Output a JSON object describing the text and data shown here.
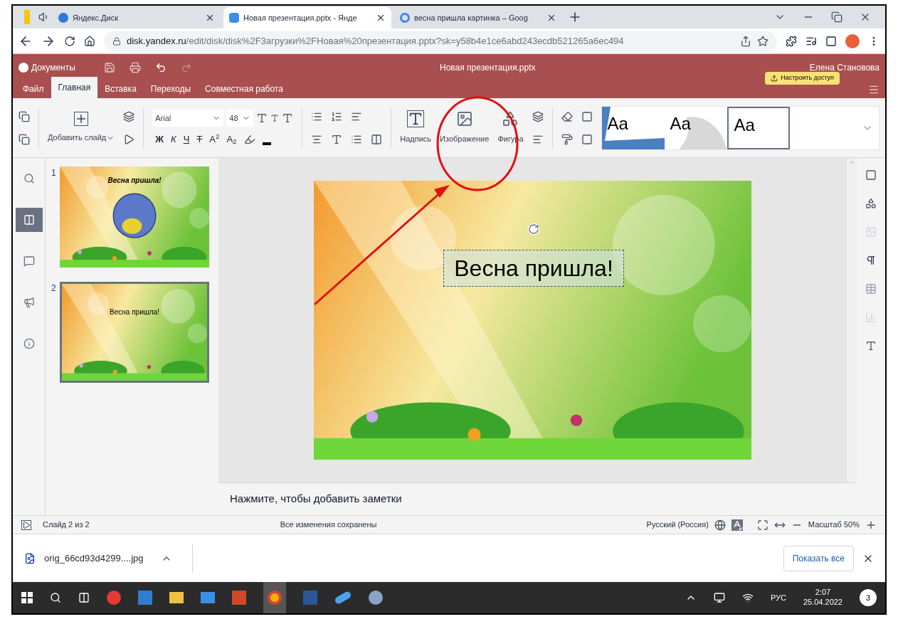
{
  "browser": {
    "tabs": [
      {
        "title": "Яндекс.Диск",
        "kind": "disk",
        "selected": false
      },
      {
        "title": "Новая презентация.pptx - Янде",
        "kind": "doc",
        "selected": true
      },
      {
        "title": "весна пришла картинка – Goog",
        "kind": "google",
        "selected": false
      }
    ],
    "url_host": "disk.yandex.ru",
    "url_path": "/edit/disk/disk%2F3агрузки%2FНовая%20презентация.pptx?sk=y58b4e1ce6abd243ecdb521265a6ec494"
  },
  "app": {
    "back_label": "Документы",
    "doc_title": "Новая презентация.pptx",
    "user_name": "Елена Становова",
    "share_button": "Настроить доступ",
    "menu_tabs": [
      {
        "label": "Файл",
        "selected": false
      },
      {
        "label": "Главная",
        "selected": true
      },
      {
        "label": "Вставка",
        "selected": false
      },
      {
        "label": "Переходы",
        "selected": false
      },
      {
        "label": "Совместная работа",
        "selected": false
      }
    ]
  },
  "ribbon": {
    "add_slide": "Добавить слайд",
    "font": "Arial",
    "size": "48",
    "format_buttons": [
      {
        "label": "Ж",
        "kind": "bold"
      },
      {
        "label": "К",
        "kind": "italic"
      },
      {
        "label": "Ч",
        "kind": "underline"
      },
      {
        "label": "Т",
        "kind": "strike"
      },
      {
        "label": "A$^{2}$",
        "kind": "plain"
      },
      {
        "label": "A$_{2}$",
        "kind": "plain"
      }
    ],
    "insert_text": "Надпись",
    "insert_image": "Изображение",
    "insert_shape": "Фигура",
    "themes": [
      {
        "label": "Aa",
        "kind": "wedge",
        "selected": false
      },
      {
        "label": "Aa",
        "kind": "cloud",
        "selected": false
      },
      {
        "label": "Aa",
        "kind": "plain",
        "selected": true
      }
    ]
  },
  "side_tools": [
    {
      "kind": "search",
      "selected": false
    },
    {
      "kind": "slides",
      "selected": true
    },
    {
      "kind": "comments",
      "selected": false
    },
    {
      "kind": "announce",
      "selected": false
    },
    {
      "kind": "info",
      "selected": false
    }
  ],
  "slides": [
    {
      "number": "1",
      "title": "Весна пришла!",
      "selected": false
    },
    {
      "number": "2",
      "title": "Весна пришла!",
      "kind": "plain",
      "selected": true
    }
  ],
  "slide_text": "Весна пришла!",
  "notes_placeholder": "Нажмите, чтобы добавить заметки",
  "status_bar": {
    "slide_counter": "Слайд 2 из 2",
    "save_status": "Все изменения сохранены",
    "language": "Русский (Россия)",
    "zoom": "Масштаб 50%"
  },
  "download": {
    "filename": "orig_66cd93d4299....jpg",
    "show_all": "Показать все"
  },
  "taskbar": {
    "language": "РУС",
    "time": "2:07",
    "date": "25.04.2022",
    "notifications": "3"
  }
}
